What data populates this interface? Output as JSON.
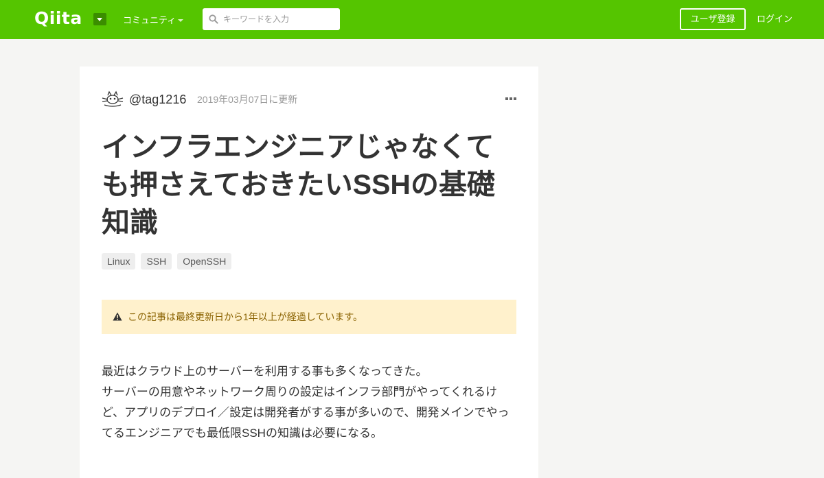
{
  "header": {
    "logo": "Qiita",
    "community_label": "コミュニティ",
    "search_placeholder": "キーワードを入力",
    "signup_label": "ユーザ登録",
    "login_label": "ログイン",
    "colors": {
      "brand": "#55c500",
      "brand_dark": "#3b8e00"
    }
  },
  "article": {
    "author": "@tag1216",
    "updated": "2019年03月07日に更新",
    "title": "インフラエンジニアじゃなくても押さえておきたいSSHの基礎知識",
    "tags": [
      "Linux",
      "SSH",
      "OpenSSH"
    ],
    "warning": "この記事は最終更新日から1年以上が経過しています。",
    "paragraphs": [
      "最近はクラウド上のサーバーを利用する事も多くなってきた。",
      "サーバーの用意やネットワーク周りの設定はインフラ部門がやってくれるけど、アプリのデプロイ／設定は開発者がする事が多いので、開発メインでやってるエンジニアでも最低限SSHの知識は必要になる。"
    ]
  },
  "icons": {
    "logo_dropdown": "caret-down-icon",
    "search": "search-icon",
    "more": "ellipsis-icon",
    "warning": "warning-triangle-icon",
    "avatar": "cat-face-avatar"
  }
}
